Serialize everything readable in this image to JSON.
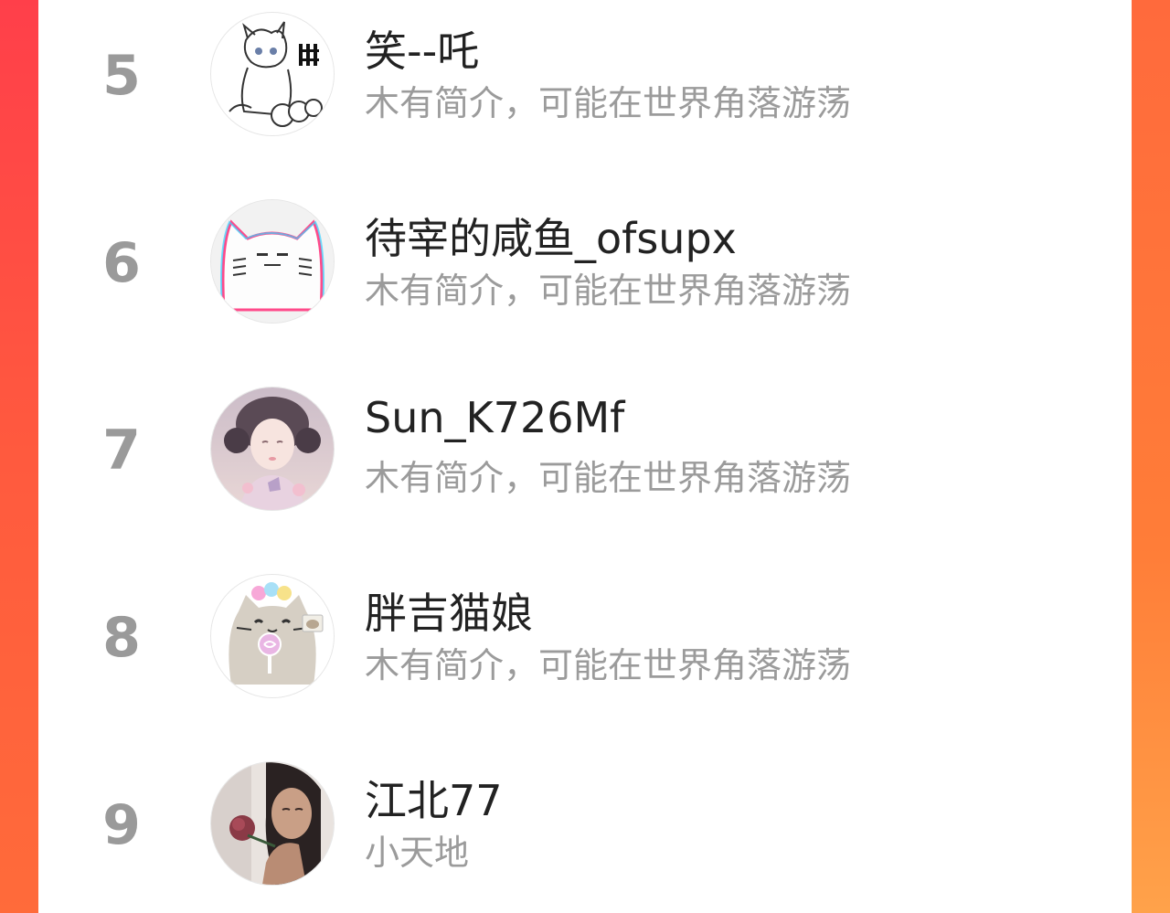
{
  "ranking": {
    "entries": [
      {
        "rank": "5",
        "name": "笑--吒",
        "bio": "木有简介，可能在世界角落游荡",
        "avatar_icon": "sketch-horse-avatar"
      },
      {
        "rank": "6",
        "name": "待宰的咸鱼_ofsupx",
        "bio": "木有简介，可能在世界角落游荡",
        "avatar_icon": "glitch-cat-avatar"
      },
      {
        "rank": "7",
        "name": "Sun_K726Mf",
        "bio": "木有简介，可能在世界角落游荡",
        "avatar_icon": "anime-girl-avatar"
      },
      {
        "rank": "8",
        "name": "胖吉猫娘",
        "bio": "木有简介，可能在世界角落游荡",
        "avatar_icon": "pusheen-cat-avatar"
      },
      {
        "rank": "9",
        "name": "江北77",
        "bio": "小天地",
        "avatar_icon": "girl-with-rose-avatar"
      }
    ]
  },
  "theme": {
    "rank_color": "#9a9a9a",
    "name_color": "#222222",
    "bio_color": "#9b9b9b",
    "frame_gradient_top": "#ff4a47",
    "frame_gradient_bottom": "#ff8a3a"
  }
}
